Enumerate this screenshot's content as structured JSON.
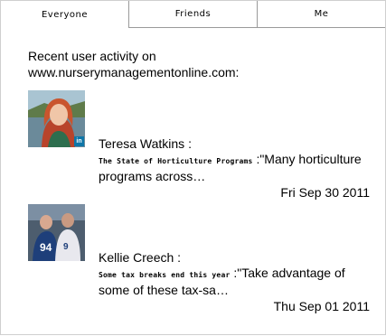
{
  "tabs": [
    {
      "label": "Everyone",
      "active": true
    },
    {
      "label": "Friends",
      "active": false
    },
    {
      "label": "Me",
      "active": false
    }
  ],
  "intro": {
    "line1": "Recent user activity on",
    "line2": "www.nurserymanagementonline.com:"
  },
  "activities": [
    {
      "name": "Teresa Watkins :",
      "post_title": "The State of Horticulture Programs",
      "excerpt": " :\"Many horticulture programs across…",
      "date": "Fri Sep 30 2011",
      "badge": "in"
    },
    {
      "name": "Kellie Creech :",
      "post_title": "Some tax breaks end this year",
      "excerpt": " :\"Take advantage of some of these tax-sa…",
      "date": "Thu Sep 01 2011"
    }
  ],
  "colors": {
    "linkedin_badge": "#0e76a8",
    "border": "#9a9a9a"
  }
}
